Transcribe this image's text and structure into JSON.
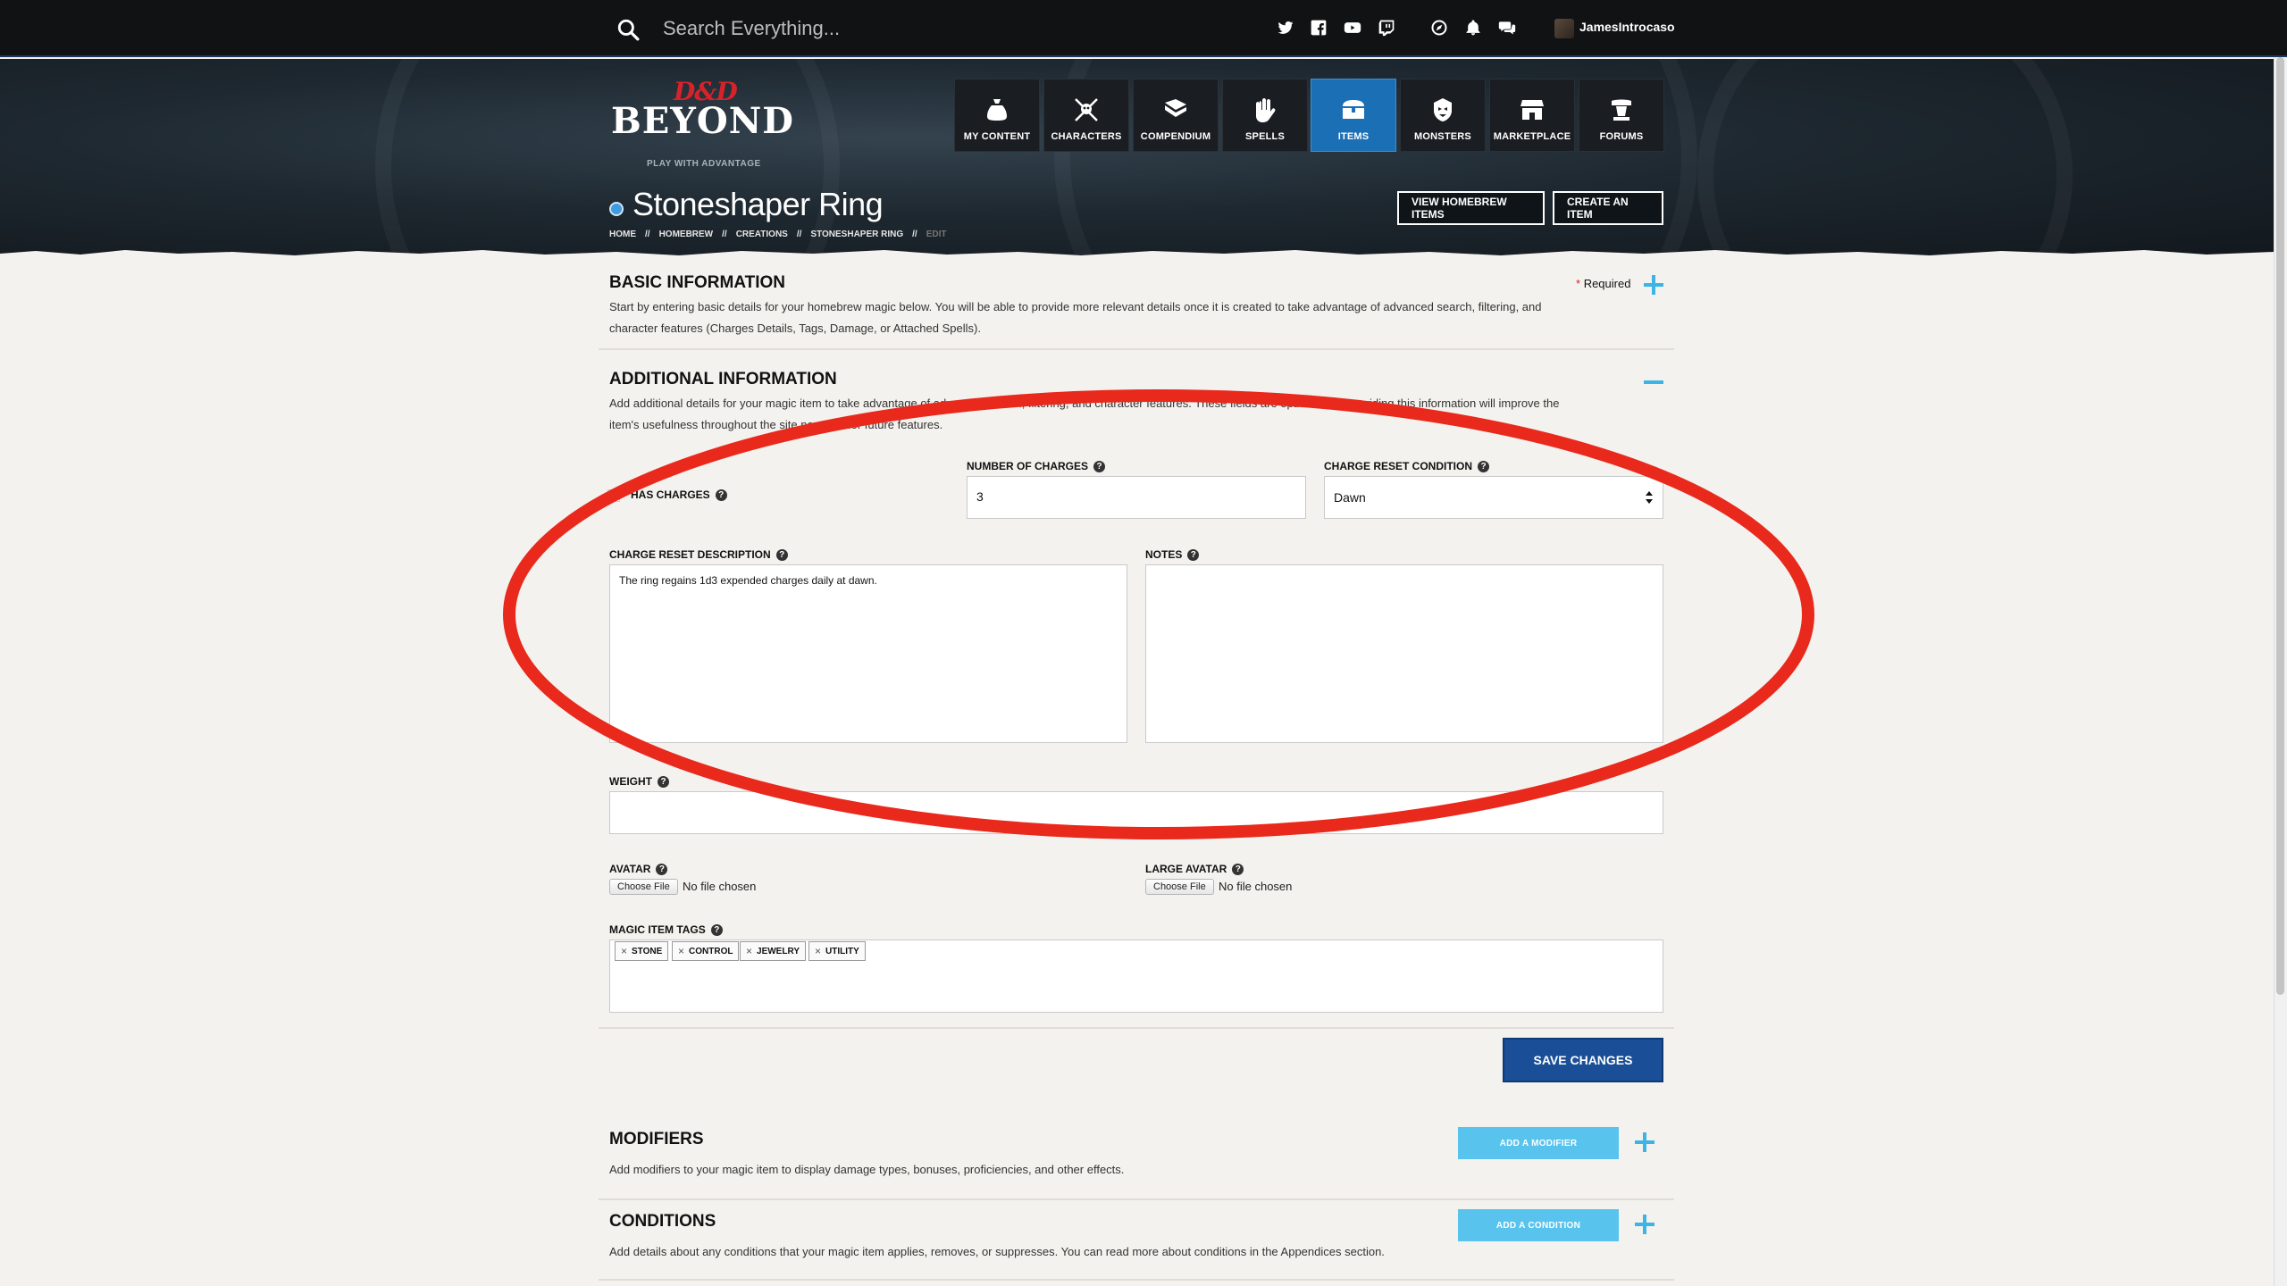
{
  "topbar": {
    "search_placeholder": "Search Everything...",
    "username": "JamesIntrocaso"
  },
  "logo": {
    "brand_top": "D&D",
    "brand_main": "BEYOND",
    "tagline": "PLAY WITH ADVANTAGE"
  },
  "nav": {
    "items": [
      {
        "label": "MY CONTENT",
        "icon": "bag-icon"
      },
      {
        "label": "CHARACTERS",
        "icon": "crossed-swords-skull-icon"
      },
      {
        "label": "COMPENDIUM",
        "icon": "book-icon"
      },
      {
        "label": "SPELLS",
        "icon": "hand-magic-icon"
      },
      {
        "label": "ITEMS",
        "icon": "chest-icon",
        "active": true
      },
      {
        "label": "MONSTERS",
        "icon": "monster-head-icon"
      },
      {
        "label": "MARKETPLACE",
        "icon": "storefront-icon"
      },
      {
        "label": "FORUMS",
        "icon": "podium-icon"
      }
    ]
  },
  "page": {
    "title": "Stoneshaper Ring",
    "breadcrumbs": [
      "HOME",
      "HOMEBREW",
      "CREATIONS",
      "STONESHAPER RING",
      "EDIT"
    ],
    "view_homebrew_label": "VIEW HOMEBREW ITEMS",
    "create_item_label": "CREATE AN ITEM"
  },
  "basic": {
    "heading": "BASIC INFORMATION",
    "required_label": "Required",
    "description_line1": "Start by entering basic details for your homebrew magic below. You will be able to provide more relevant details once it is created to take advantage of advanced search, filtering, and",
    "description_line2": "character features (Charges Details, Tags, Damage, or Attached Spells)."
  },
  "additional": {
    "heading": "ADDITIONAL INFORMATION",
    "description_line1": "Add additional details for your magic item to take advantage of advanced search, filtering, and character features. These fields are optional, but providing this information will improve the",
    "description_line2": "item's usefulness throughout the site now and for future features."
  },
  "form": {
    "has_charges_label": "HAS CHARGES",
    "has_charges_checked": false,
    "num_charges_label": "NUMBER OF CHARGES",
    "num_charges_value": "3",
    "reset_condition_label": "CHARGE RESET CONDITION",
    "reset_condition_value": "Dawn",
    "reset_desc_label": "CHARGE RESET DESCRIPTION",
    "reset_desc_value": "The ring regains 1d3 expended charges daily at dawn.",
    "notes_label": "NOTES",
    "notes_value": "",
    "weight_label": "WEIGHT",
    "weight_value": "",
    "avatar_label": "AVATAR",
    "large_avatar_label": "LARGE AVATAR",
    "choose_file_label": "Choose File",
    "no_file_label": "No file chosen",
    "tags_label": "MAGIC ITEM TAGS",
    "tags": [
      "STONE",
      "CONTROL",
      "JEWELRY",
      "UTILITY"
    ],
    "save_label": "SAVE CHANGES"
  },
  "modifiers": {
    "heading": "MODIFIERS",
    "description": "Add modifiers to your magic item to display damage types, bonuses, proficiencies, and other effects.",
    "add_label": "ADD A MODIFIER"
  },
  "conditions": {
    "heading": "CONDITIONS",
    "description": "Add details about any conditions that your magic item applies, removes, or suppresses. You can read more about conditions in the Appendices section.",
    "add_label": "ADD A CONDITION"
  },
  "colors": {
    "accent_blue": "#1b6fb5",
    "save_blue": "#1a4f97",
    "add_cyan": "#58c4ee",
    "annotation_red": "#e8291c"
  }
}
